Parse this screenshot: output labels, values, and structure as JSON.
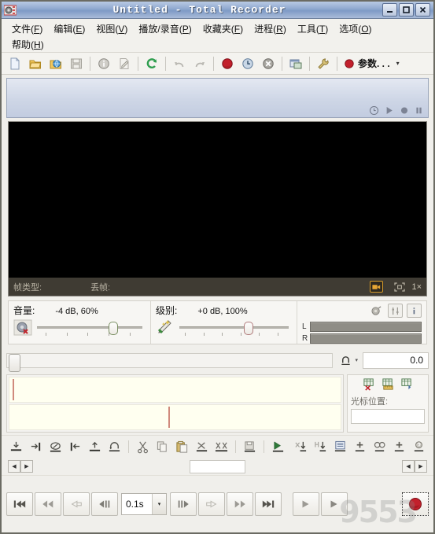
{
  "window": {
    "title": "Untitled - Total Recorder",
    "app_icon": "recorder-icon",
    "minimize": "_",
    "maximize": "□",
    "close": "×"
  },
  "menu": {
    "row1": [
      {
        "label": "文件",
        "accel": "F",
        "name": "menu-file"
      },
      {
        "label": "编辑",
        "accel": "E",
        "name": "menu-edit"
      },
      {
        "label": "视图",
        "accel": "V",
        "name": "menu-view"
      },
      {
        "label": "播放/录音",
        "accel": "P",
        "name": "menu-play-record"
      },
      {
        "label": "收藏夹",
        "accel": "F",
        "name": "menu-favorites"
      },
      {
        "label": "进程",
        "accel": "R",
        "name": "menu-process"
      },
      {
        "label": "工具",
        "accel": "T",
        "name": "menu-tools"
      },
      {
        "label": "选项",
        "accel": "O",
        "name": "menu-options"
      }
    ],
    "row2": [
      {
        "label": "帮助",
        "accel": "H",
        "name": "menu-help"
      }
    ]
  },
  "toolbar": {
    "buttons": [
      {
        "name": "new-file-icon"
      },
      {
        "name": "open-file-icon"
      },
      {
        "name": "open-web-icon"
      },
      {
        "name": "save-icon"
      },
      {
        "name": "info-icon"
      },
      {
        "name": "edit-properties-icon"
      },
      {
        "name": "refresh-icon"
      },
      {
        "name": "undo-icon"
      },
      {
        "name": "redo-icon"
      },
      {
        "name": "record-icon"
      },
      {
        "name": "schedule-icon"
      },
      {
        "name": "stop-icon"
      },
      {
        "name": "split-window-icon"
      },
      {
        "name": "settings-wrench-icon"
      }
    ],
    "param_button": {
      "label": "参数. . .",
      "caret": "▾"
    }
  },
  "infopanel": {
    "mini_controls": [
      {
        "name": "clock-icon",
        "glyph": "◴"
      },
      {
        "name": "play-icon",
        "glyph": "▶"
      },
      {
        "name": "record-dot-icon",
        "glyph": "●"
      },
      {
        "name": "pause-icon",
        "glyph": "‖"
      }
    ]
  },
  "video": {
    "frame_type_label": "帧类型:",
    "frame_type_value": "",
    "dropped_label": "丢帧:",
    "dropped_value": "",
    "camera_icon": "video-camera-icon",
    "fit_icon": "fit-to-window-icon",
    "zoom": "1×"
  },
  "volume": {
    "label": "音量:",
    "value": "-4 dB, 60%",
    "mute_icon": "mute-speaker-icon",
    "slider_pct": 72
  },
  "level": {
    "label": "级别:",
    "value": "+0 dB, 100%",
    "wand_icon": "level-wizard-icon",
    "slider_pct": 63
  },
  "meters": {
    "left_label": "L",
    "right_label": "R",
    "icons": [
      {
        "name": "sound-device-icon"
      },
      {
        "name": "mixer-icon"
      },
      {
        "name": "meter-info-icon"
      }
    ]
  },
  "position": {
    "loop_icon": "loop-icon",
    "loop_caret": "▾",
    "value": "0.0",
    "thumb_pct": 0
  },
  "waveform": {
    "cursor_section_label": "光标位置:",
    "cursor_value": "",
    "side_icons": [
      {
        "name": "delete-marker-icon"
      },
      {
        "name": "measure-marker-icon"
      },
      {
        "name": "add-marker-icon"
      }
    ],
    "track1_cursor_pct": 1,
    "track2_cursor_pct": 48
  },
  "editbar": {
    "left": [
      {
        "name": "insert-icon"
      },
      {
        "name": "append-icon"
      },
      {
        "name": "overwrite-icon"
      },
      {
        "name": "move-left-icon"
      },
      {
        "name": "move-up-icon"
      },
      {
        "name": "rotate-icon"
      }
    ],
    "clipboard": [
      {
        "name": "cut-icon"
      },
      {
        "name": "copy-icon"
      },
      {
        "name": "paste-icon"
      },
      {
        "name": "delete-selection-icon"
      },
      {
        "name": "delete-all-icon"
      }
    ],
    "save_group": [
      {
        "name": "save-selection-icon"
      }
    ],
    "play_group": [
      {
        "name": "play-selection-icon"
      }
    ],
    "right": [
      {
        "name": "mark-down-icon"
      },
      {
        "name": "split-down-icon"
      },
      {
        "name": "list-view-icon"
      },
      {
        "name": "add-region-icon"
      },
      {
        "name": "find-region-icon"
      },
      {
        "name": "add-marker-2-icon"
      },
      {
        "name": "help-region-icon"
      }
    ]
  },
  "spinrow": {
    "left_prev": "◀",
    "left_next": "▶",
    "field_value": "",
    "right_prev": "◀",
    "right_next": "▶"
  },
  "transport": {
    "buttons": [
      {
        "name": "rewind-to-start-button",
        "glyph": "⏮"
      },
      {
        "name": "rewind-button",
        "glyph": "⏪"
      },
      {
        "name": "mark-back-button",
        "glyph": "◁"
      },
      {
        "name": "step-back-button",
        "glyph": "◀‖"
      }
    ],
    "speed": {
      "value": "0.1s",
      "caret": "▾"
    },
    "buttons2": [
      {
        "name": "step-forward-button",
        "glyph": "‖▶"
      },
      {
        "name": "mark-forward-button",
        "glyph": "▷"
      },
      {
        "name": "fast-forward-button",
        "glyph": "⏩"
      },
      {
        "name": "forward-to-end-button",
        "glyph": "⏭"
      }
    ],
    "buttons3": [
      {
        "name": "play-pause-button",
        "glyph": "▶"
      },
      {
        "name": "play-button",
        "glyph": "▶"
      }
    ],
    "record": {
      "name": "record-button",
      "glyph": "●"
    },
    "watermark": "9553"
  },
  "colors": {
    "title_bar": "#8fa8cf",
    "accent_red": "#c01e1e",
    "video_bar": "#3f3b33",
    "waveform_bg": "#fffff0",
    "cursor": "#d08a7c"
  }
}
